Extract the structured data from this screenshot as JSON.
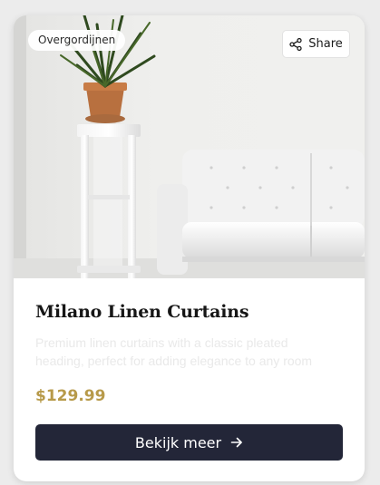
{
  "product": {
    "category_badge": "Overgordijnen",
    "share_label": "Share",
    "title": "Milano Linen Curtains",
    "description": "Premium linen curtains with a classic pleated heading, perfect for adding elegance to any room",
    "price": "$129.99",
    "cta_label": "Bekijk meer"
  },
  "icons": {
    "share": "share-icon",
    "arrow": "arrow-right-icon"
  },
  "colors": {
    "price": "#b79a4a",
    "cta_background": "#232638",
    "description_text": "#e9e9e9"
  }
}
